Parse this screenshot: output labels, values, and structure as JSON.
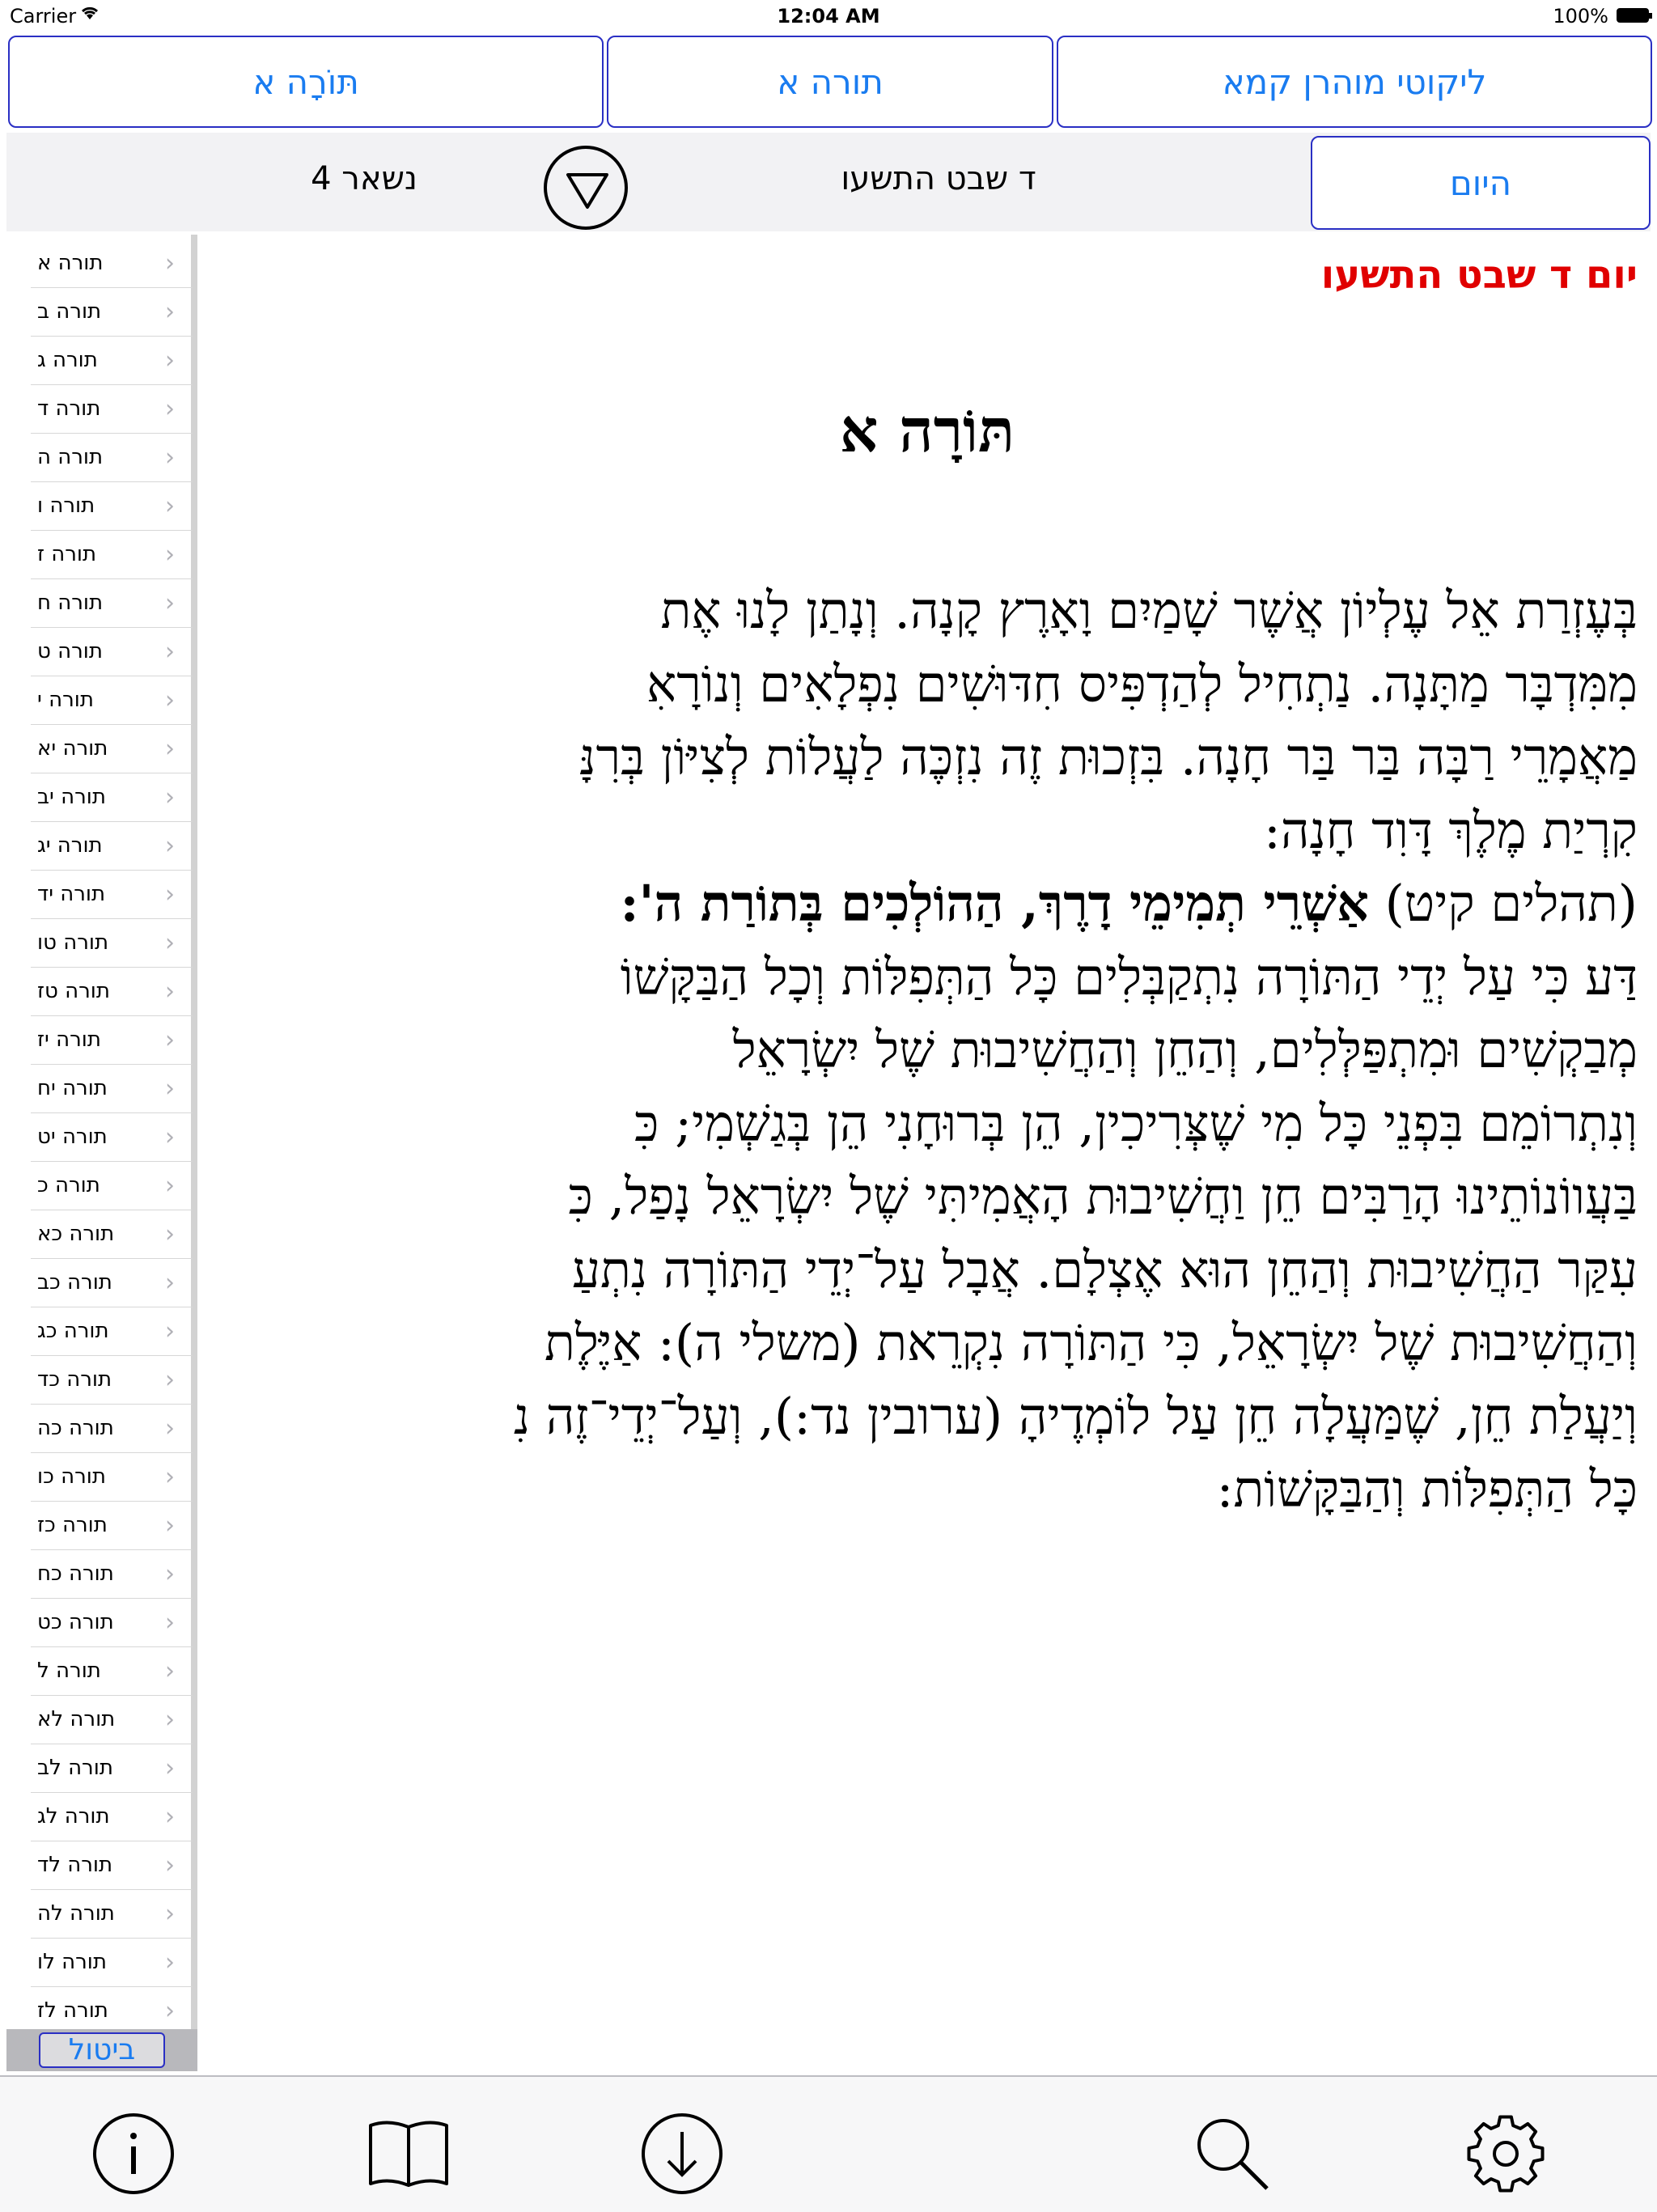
{
  "status_bar": {
    "carrier": "Carrier",
    "time": "12:04 AM",
    "battery": "100%"
  },
  "top_buttons": {
    "book": "ליקוטי מוהרן קמא",
    "torah_plain": "תורה א",
    "torah_vowel": "תּוֹרָה א"
  },
  "nav": {
    "today": "היום",
    "date": "ד שבט התשעו",
    "remaining": "נשאר 4"
  },
  "sidebar": {
    "items": [
      "תורה א",
      "תורה ב",
      "תורה ג",
      "תורה ד",
      "תורה ה",
      "תורה ו",
      "תורה ז",
      "תורה ח",
      "תורה ט",
      "תורה י",
      "תורה יא",
      "תורה יב",
      "תורה יג",
      "תורה יד",
      "תורה טו",
      "תורה טז",
      "תורה יז",
      "תורה יח",
      "תורה יט",
      "תורה כ",
      "תורה כא",
      "תורה כב",
      "תורה כג",
      "תורה כד",
      "תורה כה",
      "תורה כו",
      "תורה כז",
      "תורה כח",
      "תורה כט",
      "תורה ל",
      "תורה לא",
      "תורה לב",
      "תורה לג",
      "תורה לד",
      "תורה לה",
      "תורה לו",
      "תורה לז"
    ],
    "cancel": "ביטול"
  },
  "content": {
    "day_title": "יום ד שבט התשעו",
    "title": "תּוֹרָה א",
    "lines": [
      "בְּעֶזְרַת אֵל עֶלְיוֹן אֲשֶׁר שָׁמַיִם וָאָרֶץ קָנָה. וְנָתַן לָנוּ אֶת",
      "מִמִּדְבָּר מַתָּנָה. נַתְחִיל לְהַדְפִּיס חִדּוּשִׁים נִפְלָאִים וְנוֹרָאִ",
      "מַאֲמָרֵי רַבָּה בַּר בַּר חָנָה. בִּזְכוּת זֶה נִזְכֶּה לַעֲלוֹת לְצִיּוֹן בְּרִנָּ",
      "קִרְיַת מֶלֶךְ דָּוִד חָנָה:",
      "(תהלים קיט) אַשְׁרֵי תְמִימֵי דָרֶךְ, הַהוֹלְכִים בְּתוֹרַת ה':",
      "דַּע כִּי עַל יְדֵי הַתּוֹרָה נִתְקַבְּלִים כָּל הַתְּפִלּוֹת וְכָל הַבַּקָּשׁוֹ",
      "מְבַקְשִׁים וּמִתְפַּלְּלִים, וְהַחֵן וְהַחֲשִׁיבוּת שֶׁל יִשְׂרָאֵל",
      "וְנִתְרוֹמֵם בִּפְנֵי כָּל מִי שֶׁצְּרִיכִין, הֵן בְּרוּחָנִי הֵן בְּגַשְׁמִי; כִּ",
      "בַּעֲווֹנוֹתֵינוּ הָרַבִּים חֵן וַחֲשִׁיבוּת הָאֲמִיתִּי שֶׁל יִשְׂרָאֵל נָפַל, כִּ",
      "עִקַּר הַחֲשִׁיבוּת וְהַחֵן הוּא אֶצְלָם. אֲבָל עַל־יְדֵי הַתּוֹרָה נִתְעַ",
      "וְהַחֲשִׁיבוּת שֶׁל יִשְׂרָאֵל, כִּי הַתּוֹרָה נִקְרֵאת (משלי ה): אַיֶּלֶת",
      "וְיַעֲלַת חֵן, שֶׁמַּעֲלָה חֵן עַל לוֹמְדֶיהָ (ערובין נד:), וְעַל־יְדֵי־זֶה נִ",
      "כָּל הַתְּפִלּוֹת וְהַבַּקָּשׁוֹת:"
    ],
    "line5_prefix": "(תהלים קיט) ",
    "line5_bold": "אַשְׁרֵי תְמִימֵי דָרֶךְ, הַהוֹלְכִים בְּתוֹרַת ה':"
  },
  "tabbar": {
    "icons": [
      "info-icon",
      "book-icon",
      "download-icon",
      "search-icon",
      "settings-icon"
    ]
  },
  "colors": {
    "accent": "#1a7cf0",
    "border": "#2a2fc4",
    "day_title": "#e00000"
  }
}
